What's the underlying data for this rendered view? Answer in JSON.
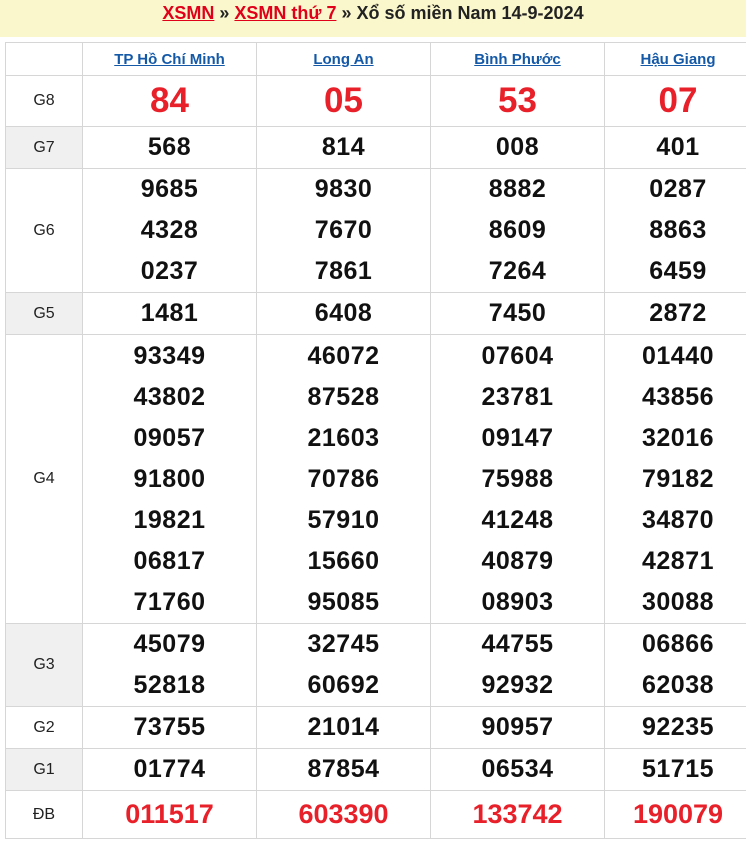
{
  "header": {
    "link1": "XSMN",
    "sep1": " » ",
    "link2": "XSMN thứ 7",
    "sep2": " » ",
    "title": "Xổ số miền Nam 14-9-2024"
  },
  "provinces": [
    "TP Hồ Chí Minh",
    "Long An",
    "Bình Phước",
    "Hậu Giang"
  ],
  "prizes": {
    "g8": {
      "label": "G8",
      "values": [
        "84",
        "05",
        "53",
        "07"
      ]
    },
    "g7": {
      "label": "G7",
      "values": [
        "568",
        "814",
        "008",
        "401"
      ]
    },
    "g6": {
      "label": "G6",
      "values": [
        [
          "9685",
          "4328",
          "0237"
        ],
        [
          "9830",
          "7670",
          "7861"
        ],
        [
          "8882",
          "8609",
          "7264"
        ],
        [
          "0287",
          "8863",
          "6459"
        ]
      ]
    },
    "g5": {
      "label": "G5",
      "values": [
        "1481",
        "6408",
        "7450",
        "2872"
      ]
    },
    "g4": {
      "label": "G4",
      "values": [
        [
          "93349",
          "43802",
          "09057",
          "91800",
          "19821",
          "06817",
          "71760"
        ],
        [
          "46072",
          "87528",
          "21603",
          "70786",
          "57910",
          "15660",
          "95085"
        ],
        [
          "07604",
          "23781",
          "09147",
          "75988",
          "41248",
          "40879",
          "08903"
        ],
        [
          "01440",
          "43856",
          "32016",
          "79182",
          "34870",
          "42871",
          "30088"
        ]
      ]
    },
    "g3": {
      "label": "G3",
      "values": [
        [
          "45079",
          "52818"
        ],
        [
          "32745",
          "60692"
        ],
        [
          "44755",
          "92932"
        ],
        [
          "06866",
          "62038"
        ]
      ]
    },
    "g2": {
      "label": "G2",
      "values": [
        "73755",
        "21014",
        "90957",
        "92235"
      ]
    },
    "g1": {
      "label": "G1",
      "values": [
        "01774",
        "87854",
        "06534",
        "51715"
      ]
    },
    "db": {
      "label": "ĐB",
      "values": [
        "011517",
        "603390",
        "133742",
        "190079"
      ]
    }
  },
  "colors": {
    "accent_red": "#e8202a",
    "link_blue": "#1459a8",
    "header_bg": "#fbf7cc",
    "row_shade": "#f0f0f0"
  }
}
